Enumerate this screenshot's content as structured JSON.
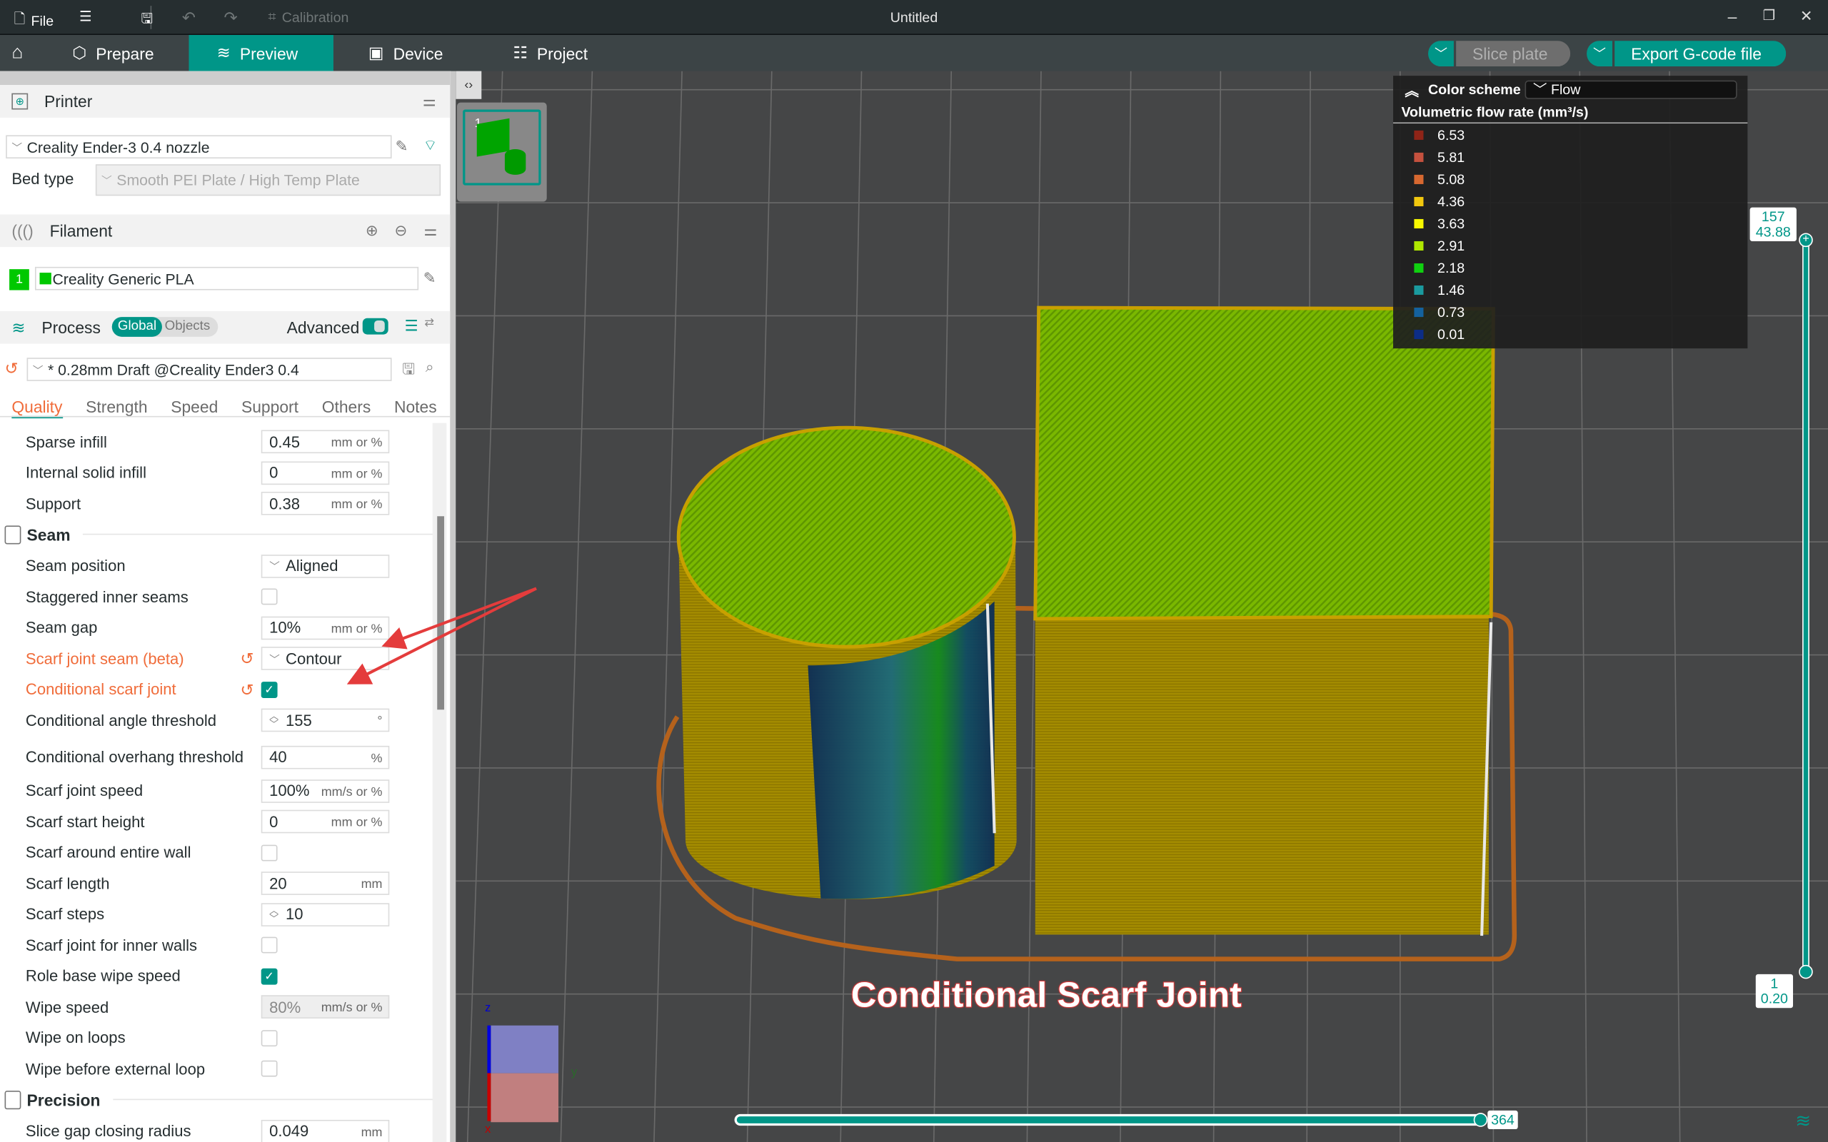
{
  "titlebar": {
    "file_label": "File",
    "calibration_label": "Calibration",
    "window_title": "Untitled",
    "minimize": "–",
    "maximize": "❐",
    "close": "✕"
  },
  "nav": {
    "tabs": [
      {
        "label": "Prepare",
        "icon": "cube-icon"
      },
      {
        "label": "Preview",
        "icon": "layers-icon",
        "active": true
      },
      {
        "label": "Device",
        "icon": "printer-device-icon"
      },
      {
        "label": "Project",
        "icon": "project-list-icon"
      }
    ],
    "slice_label": "Slice plate",
    "export_label": "Export G-code file"
  },
  "sidebar": {
    "printer": {
      "title": "Printer",
      "preset": "Creality Ender-3 0.4 nozzle",
      "bed_type_label": "Bed type",
      "bed_type_value": "Smooth PEI Plate / High Temp Plate"
    },
    "filament": {
      "title": "Filament",
      "slot_number": "1",
      "slot_color": "#00c800",
      "preset": "Creality Generic PLA"
    },
    "process": {
      "title": "Process",
      "toggle_global": "Global",
      "toggle_objects": "Objects",
      "advanced_label": "Advanced",
      "advanced_on": true,
      "preset": "* 0.28mm Draft @Creality Ender3 0.4",
      "tabs": [
        "Quality",
        "Strength",
        "Speed",
        "Support",
        "Others",
        "Notes"
      ],
      "active_tab": "Quality"
    },
    "settings": {
      "rows_top": [
        {
          "label": "Sparse infill",
          "value": "0.45",
          "unit": "mm or %"
        },
        {
          "label": "Internal solid infill",
          "value": "0",
          "unit": "mm or %"
        },
        {
          "label": "Support",
          "value": "0.38",
          "unit": "mm or %"
        }
      ],
      "seam_group": "Seam",
      "seam_rows": [
        {
          "label": "Seam position",
          "type": "select",
          "value": "Aligned"
        },
        {
          "label": "Staggered inner seams",
          "type": "checkbox",
          "checked": false
        },
        {
          "label": "Seam gap",
          "type": "input",
          "value": "10%",
          "unit": "mm or %"
        },
        {
          "label": "Scarf joint seam (beta)",
          "type": "select",
          "value": "Contour",
          "modified": true
        },
        {
          "label": "Conditional scarf joint",
          "type": "checkbox",
          "checked": true,
          "modified": true
        },
        {
          "label": "Conditional angle threshold",
          "type": "spin",
          "value": "155",
          "unit": "°"
        },
        {
          "label": "Conditional overhang threshold",
          "type": "input",
          "value": "40",
          "unit": "%"
        },
        {
          "label": "Scarf joint speed",
          "type": "input",
          "value": "100%",
          "unit": "mm/s or %"
        },
        {
          "label": "Scarf start height",
          "type": "input",
          "value": "0",
          "unit": "mm or %"
        },
        {
          "label": "Scarf around entire wall",
          "type": "checkbox",
          "checked": false
        },
        {
          "label": "Scarf length",
          "type": "input",
          "value": "20",
          "unit": "mm"
        },
        {
          "label": "Scarf steps",
          "type": "spin",
          "value": "10",
          "unit": ""
        },
        {
          "label": "Scarf joint for inner walls",
          "type": "checkbox",
          "checked": false
        },
        {
          "label": "Role base wipe speed",
          "type": "checkbox",
          "checked": true
        },
        {
          "label": "Wipe speed",
          "type": "input",
          "value": "80%",
          "unit": "mm/s or %",
          "disabled": true
        },
        {
          "label": "Wipe on loops",
          "type": "checkbox",
          "checked": false
        },
        {
          "label": "Wipe before external loop",
          "type": "checkbox",
          "checked": false
        }
      ],
      "precision_group": "Precision",
      "precision_rows": [
        {
          "label": "Slice gap closing radius",
          "value": "0.049",
          "unit": "mm"
        }
      ]
    }
  },
  "viewport": {
    "plate_number": "1",
    "legend": {
      "title": "Color scheme",
      "scheme": "Flow",
      "subtitle": "Volumetric flow rate (mm³/s)",
      "items": [
        {
          "value": "6.53",
          "color": "#8f2417"
        },
        {
          "value": "5.81",
          "color": "#c5513e"
        },
        {
          "value": "5.08",
          "color": "#d76830"
        },
        {
          "value": "4.36",
          "color": "#f2c80e"
        },
        {
          "value": "3.63",
          "color": "#f8f800"
        },
        {
          "value": "2.91",
          "color": "#b0e800"
        },
        {
          "value": "2.18",
          "color": "#10d010"
        },
        {
          "value": "1.46",
          "color": "#1a9a9e"
        },
        {
          "value": "0.73",
          "color": "#14629e"
        },
        {
          "value": "0.01",
          "color": "#0c2d86"
        }
      ]
    },
    "layer_slider": {
      "top_layer": "157",
      "top_height": "43.88",
      "bottom_layer": "1",
      "bottom_height": "0.20"
    },
    "move_slider": {
      "value": "364",
      "fraction": 1.0
    },
    "axes": {
      "z": "z",
      "y": "y",
      "x": "x"
    },
    "annotation": "Conditional Scarf Joint",
    "accent_color": "#009688"
  }
}
